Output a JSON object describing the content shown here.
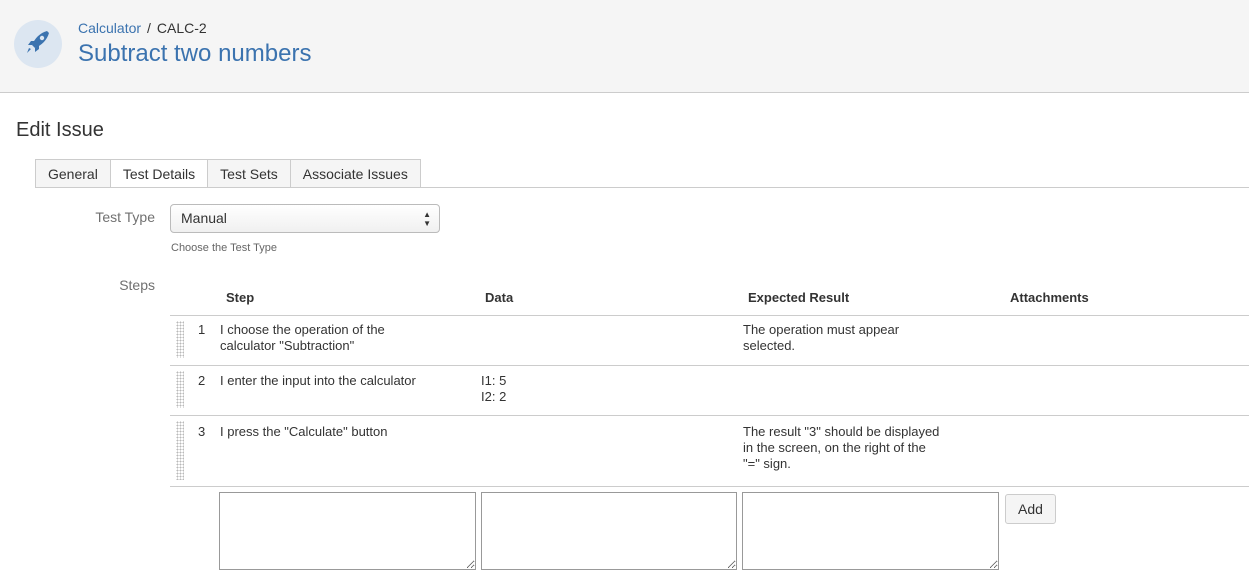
{
  "header": {
    "project_link": "Calculator",
    "separator": "/",
    "issue_key": "CALC-2",
    "title": "Subtract two numbers",
    "avatar_icon": "rocket-icon",
    "accent": "#3b73af"
  },
  "edit": {
    "title": "Edit Issue",
    "tabs": [
      {
        "label": "General",
        "active": false
      },
      {
        "label": "Test Details",
        "active": true
      },
      {
        "label": "Test Sets",
        "active": false
      },
      {
        "label": "Associate Issues",
        "active": false
      }
    ],
    "test_type": {
      "label": "Test Type",
      "value": "Manual",
      "help": "Choose the Test Type"
    },
    "steps": {
      "label": "Steps",
      "columns": [
        "Step",
        "Data",
        "Expected Result",
        "Attachments"
      ],
      "rows": [
        {
          "num": "1",
          "step": "I choose the operation of the\ncalculator \"Subtraction\"",
          "data": "",
          "expected": "The operation must appear\nselected.",
          "attachments": ""
        },
        {
          "num": "2",
          "step": "I enter the input into the calculator",
          "data": "I1: 5\nI2: 2",
          "expected": "",
          "attachments": ""
        },
        {
          "num": "3",
          "step": "I press the \"Calculate\" button",
          "data": "",
          "expected": "The result \"3\" should be displayed\nin the screen, on the right of the\n\"=\" sign.",
          "attachments": ""
        }
      ],
      "new_step": {
        "step": "",
        "data": "",
        "expected": ""
      },
      "add_label": "Add"
    }
  }
}
